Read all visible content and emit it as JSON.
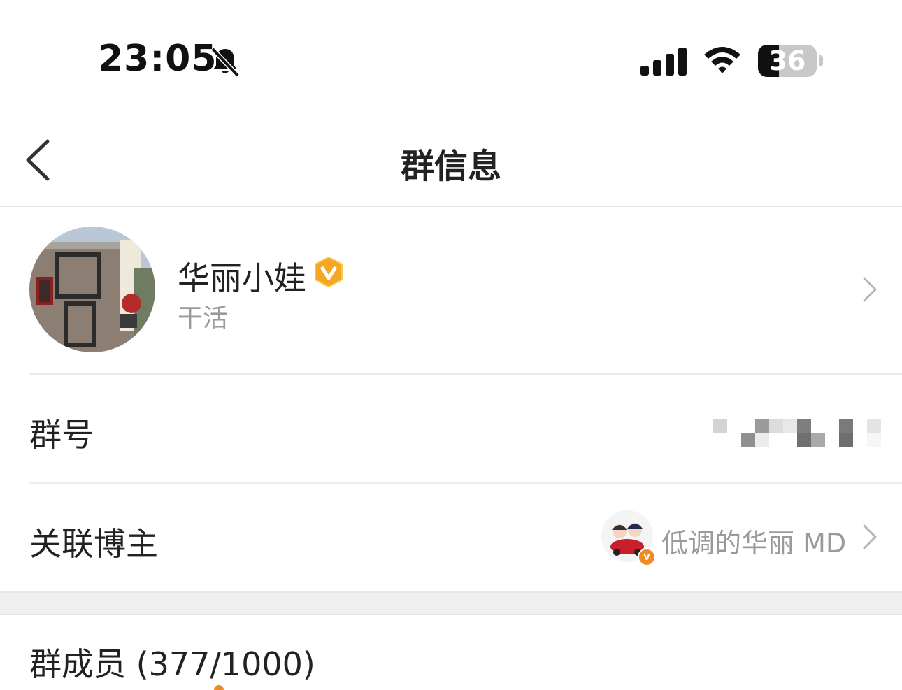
{
  "status_bar": {
    "time": "23:05",
    "battery_level": "36",
    "battery_fraction": 0.36,
    "icons": [
      "bell-muted-icon",
      "cellular-signal-icon",
      "wifi-icon",
      "battery-icon"
    ]
  },
  "nav": {
    "back_icon": "chevron-left-icon",
    "title": "群信息"
  },
  "group": {
    "name": "华丽小娃",
    "description": "干活",
    "badge_icon": "verified-v-badge-icon",
    "badge_color": "#f5a623"
  },
  "rows": {
    "group_number_label": "群号",
    "linked_blogger_label": "关联博主",
    "linked_blogger_name": "低调的华丽 MD",
    "linked_blogger_badge": "v"
  },
  "members": {
    "label": "群成员 (377/1000)"
  },
  "colors": {
    "accent": "#f08a24",
    "secondary_text": "#9a9a9a",
    "divider": "#ececec"
  }
}
